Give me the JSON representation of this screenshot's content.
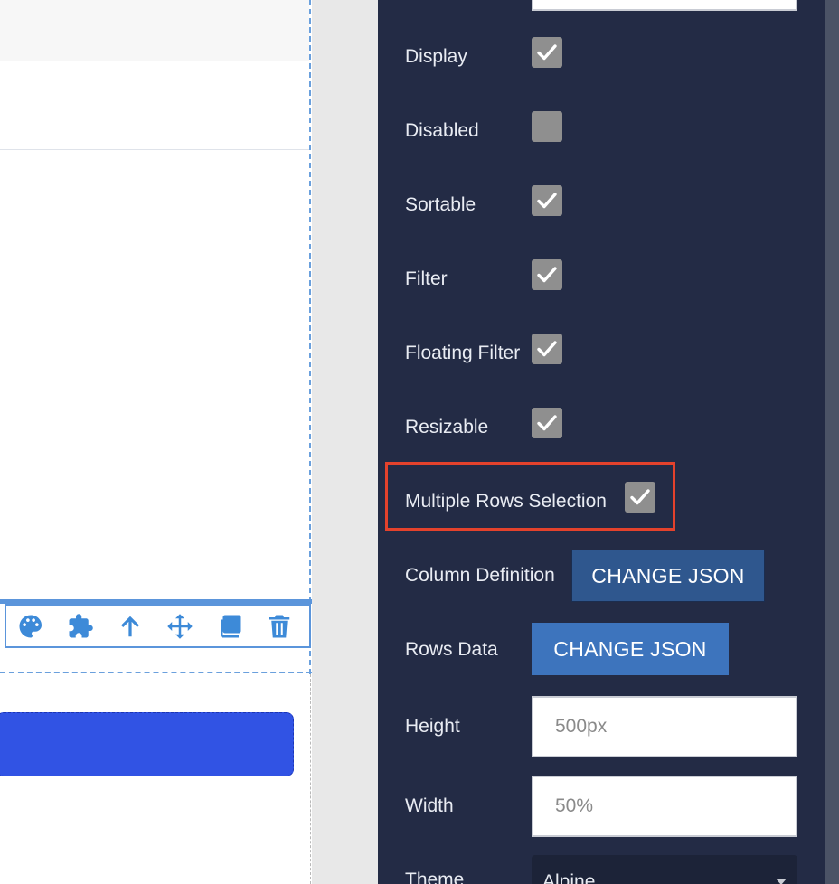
{
  "toolbar": {
    "icons": [
      "palette-icon",
      "puzzle-icon",
      "arrow-up-icon",
      "move-icon",
      "copy-icon",
      "trash-icon"
    ]
  },
  "props": {
    "display": {
      "label": "Display",
      "checked": true
    },
    "disabled": {
      "label": "Disabled",
      "checked": false
    },
    "sortable": {
      "label": "Sortable",
      "checked": true
    },
    "filter": {
      "label": "Filter",
      "checked": true
    },
    "floating_filter": {
      "label": "Floating Filter",
      "checked": true
    },
    "resizable": {
      "label": "Resizable",
      "checked": true
    },
    "multiple_rows_selection": {
      "label": "Multiple Rows Selection",
      "checked": true
    },
    "column_definition": {
      "label": "Column Definition",
      "button": "CHANGE JSON"
    },
    "rows_data": {
      "label": "Rows Data",
      "button": "CHANGE JSON"
    },
    "height": {
      "label": "Height",
      "placeholder": "500px"
    },
    "width": {
      "label": "Width",
      "placeholder": "50%"
    },
    "theme": {
      "label": "Theme",
      "value": "Alpine"
    }
  },
  "colors": {
    "panel_bg": "#232b45",
    "accent_blue": "#3d74bd",
    "highlight": "#e4422c",
    "canvas_button": "#3153e4"
  }
}
